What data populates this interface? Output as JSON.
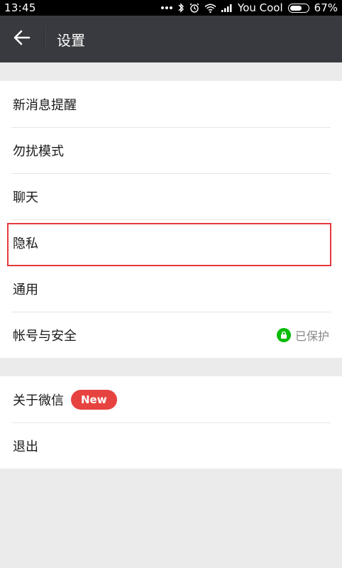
{
  "status_bar": {
    "time": "13:45",
    "carrier": "You Cool",
    "battery_percent": "67%",
    "battery_level": 0.67,
    "icons": [
      "more-dots-icon",
      "bluetooth-icon",
      "alarm-icon",
      "wifi-icon",
      "signal-icon",
      "battery-icon"
    ]
  },
  "header": {
    "title": "设置",
    "back_icon": "back-arrow-icon"
  },
  "settings": {
    "group1": [
      {
        "label": "新消息提醒"
      },
      {
        "label": "勿扰模式"
      },
      {
        "label": "聊天"
      },
      {
        "label": "隐私"
      },
      {
        "label": "通用"
      },
      {
        "label": "帐号与安全",
        "status": "已保护",
        "status_icon": "lock-icon"
      }
    ],
    "group2": [
      {
        "label": "关于微信",
        "badge": "New"
      },
      {
        "label": "退出"
      }
    ]
  },
  "colors": {
    "header_bg": "#393a3f",
    "background": "#ebebeb",
    "highlight": "#e3383d",
    "badge": "#e64340",
    "protected_green": "#09bb07"
  }
}
